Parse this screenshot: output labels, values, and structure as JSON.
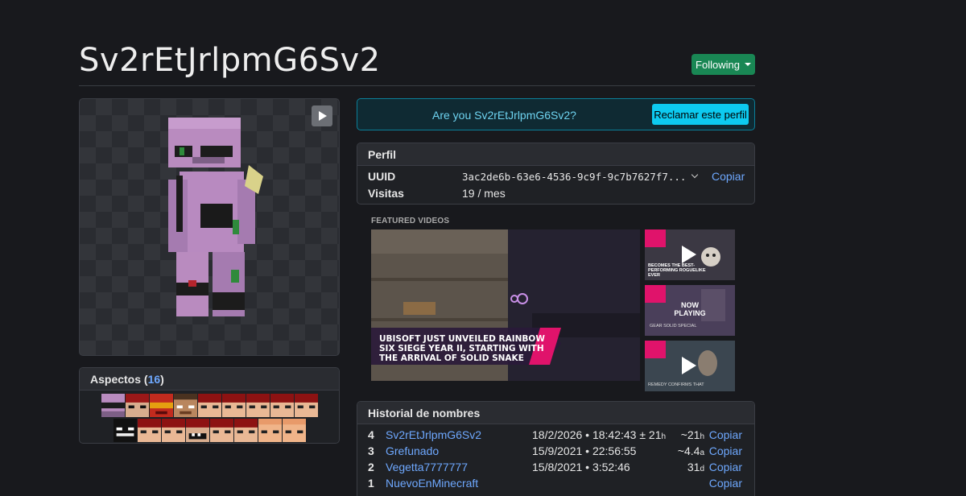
{
  "profile": {
    "username": "Sv2rEtJrlpmG6Sv2",
    "follow_label": "Following"
  },
  "claim": {
    "question": "Are you Sv2rEtJrlpmG6Sv2?",
    "button_label": "Reclamar este perfil"
  },
  "perfil": {
    "header": "Perfil",
    "uuid_label": "UUID",
    "uuid_value": "3ac2de6b-63e6-4536-9c9f-9c7b7627f7...",
    "copy_label": "Copiar",
    "visits_label": "Visitas",
    "visits_value": "19 / mes"
  },
  "aspects": {
    "label": "Aspectos (",
    "count": "16",
    "close": ")"
  },
  "videos": {
    "label": "FEATURED VIDEOS",
    "main_caption_line1": "UBISOFT JUST UNVEILED RAINBOW",
    "main_caption_line2": "SIX SIEGE YEAR II, STARTING WITH",
    "main_caption_line3": "THE ARRIVAL OF SOLID SNAKE",
    "thumb1_text": "BECOMES THE BEST-PERFORMING ROGUELIKE EVER",
    "thumb2_text": "NOW PLAYING",
    "thumb2_sub": "GEAR SOLID SPECIAL",
    "thumb3_text": "REMEDY CONFIRMS THAT"
  },
  "historial": {
    "header": "Historial de nombres",
    "rows": [
      {
        "num": "4",
        "name": "Sv2rEtJrlpmG6Sv2",
        "date": "18/2/2026 • 18:42:43 ± 21",
        "date_unit": "h",
        "ago": "~21",
        "ago_unit": "h",
        "copy": "Copiar"
      },
      {
        "num": "3",
        "name": "Grefunado",
        "date": "15/9/2021 • 22:56:55",
        "date_unit": "",
        "ago": "~4.4",
        "ago_unit": "a",
        "copy": "Copiar"
      },
      {
        "num": "2",
        "name": "Vegetta7777777",
        "date": "15/8/2021 • 3:52:46",
        "date_unit": "",
        "ago": "31",
        "ago_unit": "d",
        "copy": "Copiar"
      },
      {
        "num": "1",
        "name": "NuevoEnMinecraft",
        "date": "",
        "date_unit": "",
        "ago": "",
        "ago_unit": "",
        "copy": "Copiar"
      }
    ]
  },
  "colors": {
    "accent_link": "#6ea8fe",
    "follow_green": "#198754",
    "claim_cyan": "#0dcaf0",
    "background": "#18191d"
  },
  "icons": [
    "play-icon",
    "chevron-down-icon",
    "caret-down-icon"
  ]
}
